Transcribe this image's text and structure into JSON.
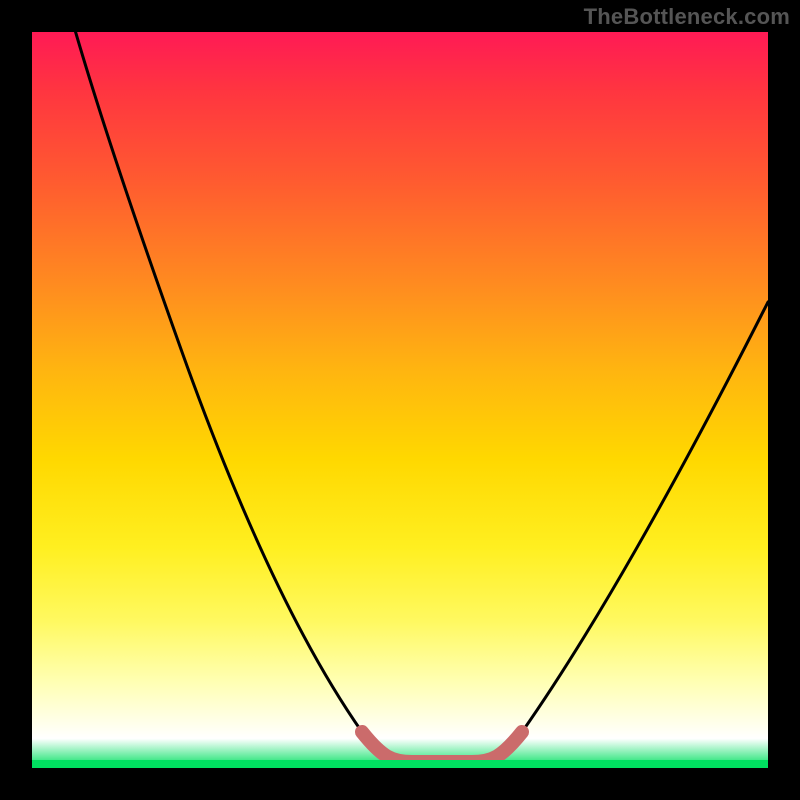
{
  "watermark": "TheBottleneck.com",
  "chart_data": {
    "type": "line",
    "title": "",
    "xlabel": "",
    "ylabel": "",
    "xlim": [
      0,
      100
    ],
    "ylim": [
      0,
      100
    ],
    "series": [
      {
        "name": "bottleneck-curve",
        "x": [
          0,
          8,
          16,
          24,
          32,
          40,
          44,
          48,
          52,
          56,
          60,
          62,
          66,
          72,
          80,
          88,
          96,
          100
        ],
        "values": [
          105,
          92,
          78,
          62,
          46,
          30,
          20,
          10,
          4,
          1,
          2,
          4,
          12,
          24,
          40,
          52,
          62,
          66
        ]
      }
    ],
    "optimal_zone": {
      "x_start": 48,
      "x_end": 62
    },
    "colors": {
      "background_top": "#ff1a55",
      "background_bottom": "#00e060",
      "curve": "#000000",
      "optimal_marker": "#cb6b6b"
    }
  }
}
